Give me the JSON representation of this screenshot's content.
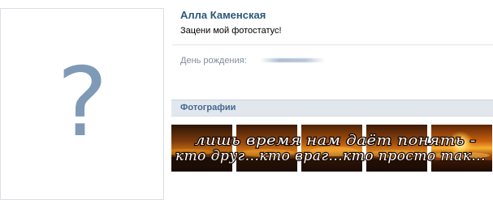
{
  "avatar": {
    "glyph": "?"
  },
  "profile": {
    "name": "Алла Каменская",
    "status": "Зацени мой фотостатус!"
  },
  "info": {
    "birthday_label": "День рождения:"
  },
  "photos": {
    "title": "Фотографии",
    "caption_line1": "лишь время нам даёт понять -",
    "caption_line2": "кто друг...кто враг...кто просто так...",
    "count": 5
  },
  "colors": {
    "name_link": "#2b587a",
    "header_bg": "#e1e7ed",
    "header_text": "#45688e",
    "label_gray": "#808e9d",
    "avatar_glyph": "#7f9ab7"
  }
}
